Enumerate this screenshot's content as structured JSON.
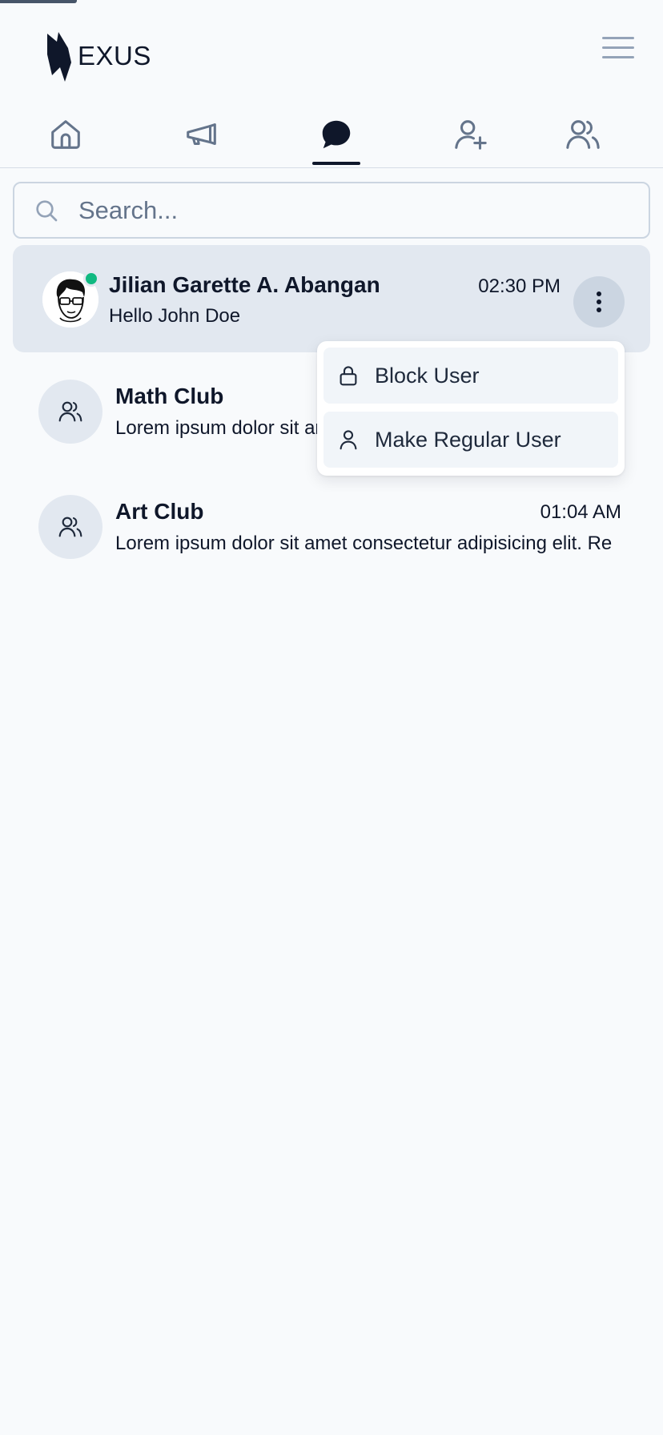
{
  "app": {
    "logo_text": "EXUS",
    "colors": {
      "accent": "#0f172a",
      "online": "#10b981",
      "active_row": "#e2e8f0",
      "icon": "#64748b"
    }
  },
  "header": {
    "menu_icon": "hamburger-icon"
  },
  "tabs": [
    {
      "icon": "home-icon"
    },
    {
      "icon": "megaphone-icon"
    },
    {
      "icon": "chat-bubble-icon",
      "active": true
    },
    {
      "icon": "user-plus-icon"
    },
    {
      "icon": "users-icon"
    }
  ],
  "search": {
    "placeholder": "Search...",
    "value": ""
  },
  "chats": [
    {
      "name": "Jilian Garette A. Abangan",
      "message": "Hello John Doe",
      "time": "02:30 PM",
      "online": true,
      "avatar": "cartoon-avatar"
    },
    {
      "name": "Math Club",
      "message": "Lorem ipsum dolor sit amet consectetur adipisicing elit. Re",
      "time": "",
      "avatar": "group-icon"
    },
    {
      "name": "Art Club",
      "message": "Lorem ipsum dolor sit amet consectetur adipisicing elit. Re",
      "time": "01:04 AM",
      "avatar": "group-icon"
    }
  ],
  "dropdown": {
    "items": [
      {
        "label": "Block User",
        "icon": "lock-icon"
      },
      {
        "label": "Make Regular User",
        "icon": "user-icon"
      }
    ]
  }
}
